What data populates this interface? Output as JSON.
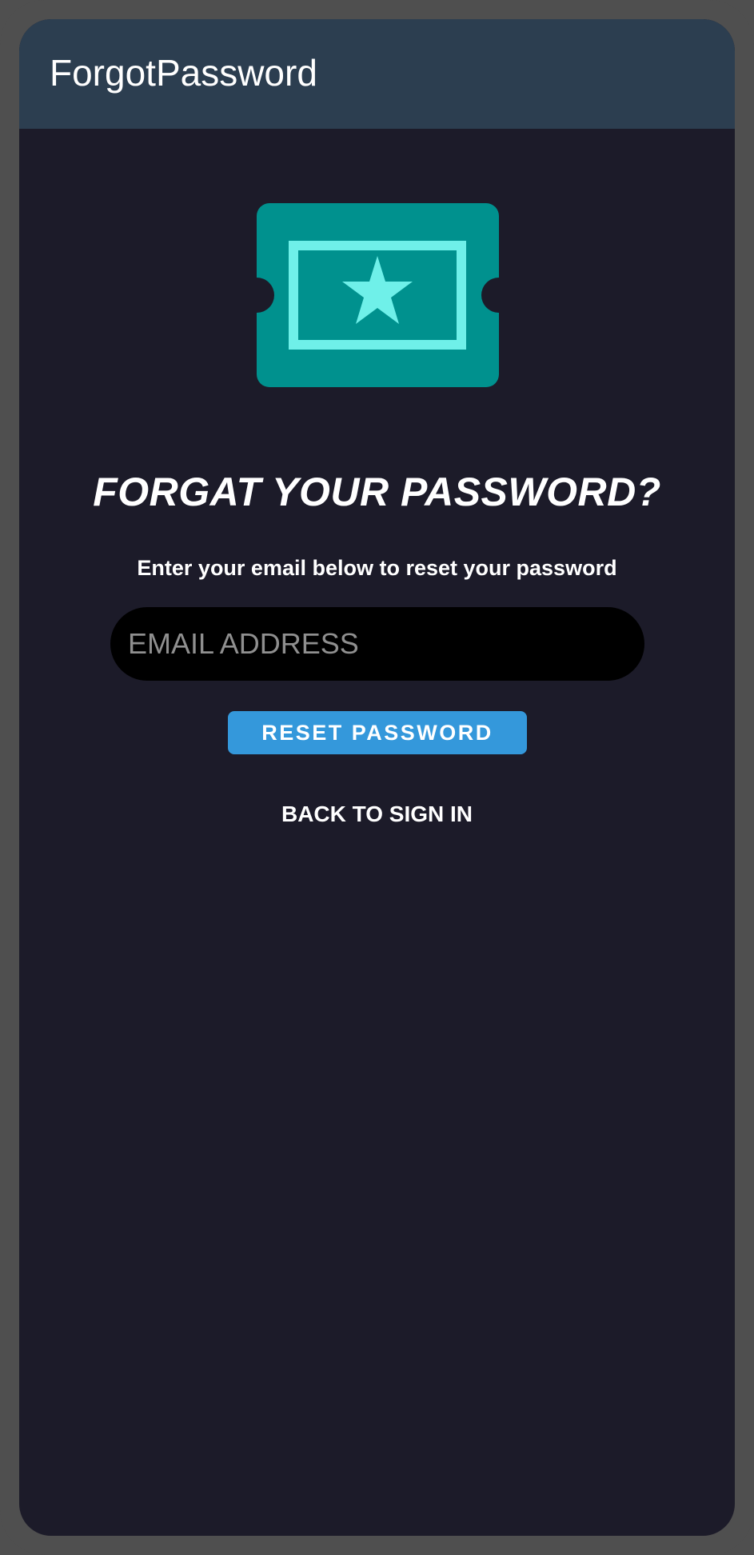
{
  "app_bar": {
    "title": "ForgotPassword"
  },
  "logo": {
    "icon": "ticket-star-icon",
    "colors": {
      "ticket": "#00918e",
      "accent": "#6ff0e9"
    }
  },
  "content": {
    "headline": "FORGAT YOUR PASSWORD?",
    "subtext": "Enter your email below to reset your password",
    "email_field": {
      "value": "",
      "placeholder": "EMAIL ADDRESS"
    },
    "reset_button_label": "RESET PASSWORD",
    "back_link_label": "BACK TO SIGN IN"
  },
  "theme": {
    "background": "#1c1b29",
    "app_bar": "#2c3e50",
    "button": "#3498db",
    "frame": "#4f4f4f"
  }
}
